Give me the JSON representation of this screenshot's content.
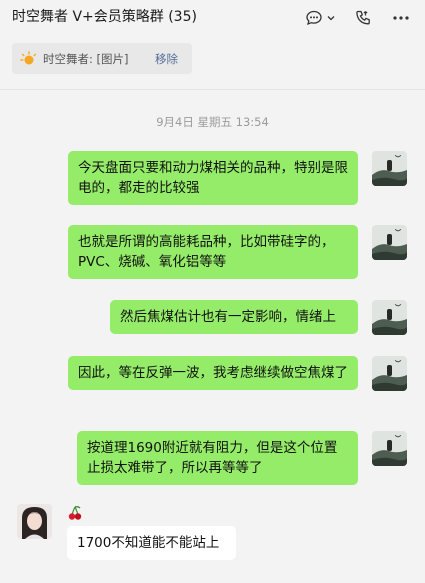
{
  "header": {
    "title": "时空舞者 V+会员策略群 (35)",
    "icons": [
      "chat-bubble-icon",
      "chevron-down-icon",
      "voice-call-icon",
      "more-icon"
    ]
  },
  "pinned": {
    "text": "时空舞者: [图片]",
    "remove_label": "移除",
    "icon": "sun-icon"
  },
  "timestamp": "9月4日 星期五 13:54",
  "messages": [
    {
      "text": "今天盘面只要和动力煤相关的品种，特别是限电的，都走的比较强",
      "direction": "out"
    },
    {
      "text": "也就是所谓的高能耗品种，比如带硅字的，PVC、烧碱、氧化铝等等",
      "direction": "out"
    },
    {
      "text": "然后焦煤估计也有一定影响，情绪上",
      "direction": "out"
    },
    {
      "text": "因此，等在反弹一波，我考虑继续做空焦煤了",
      "direction": "out"
    },
    {
      "text": "按道理1690附近就有阻力，但是这个位置止损太难带了，所以再等等了",
      "direction": "out"
    },
    {
      "text": "1700不知道能不能站上",
      "direction": "in"
    }
  ],
  "sender_badge": "cherry-icon",
  "colors": {
    "outgoing": "#95ec69",
    "incoming": "#ffffff",
    "link": "#576b95",
    "background": "#f3f3f3"
  }
}
